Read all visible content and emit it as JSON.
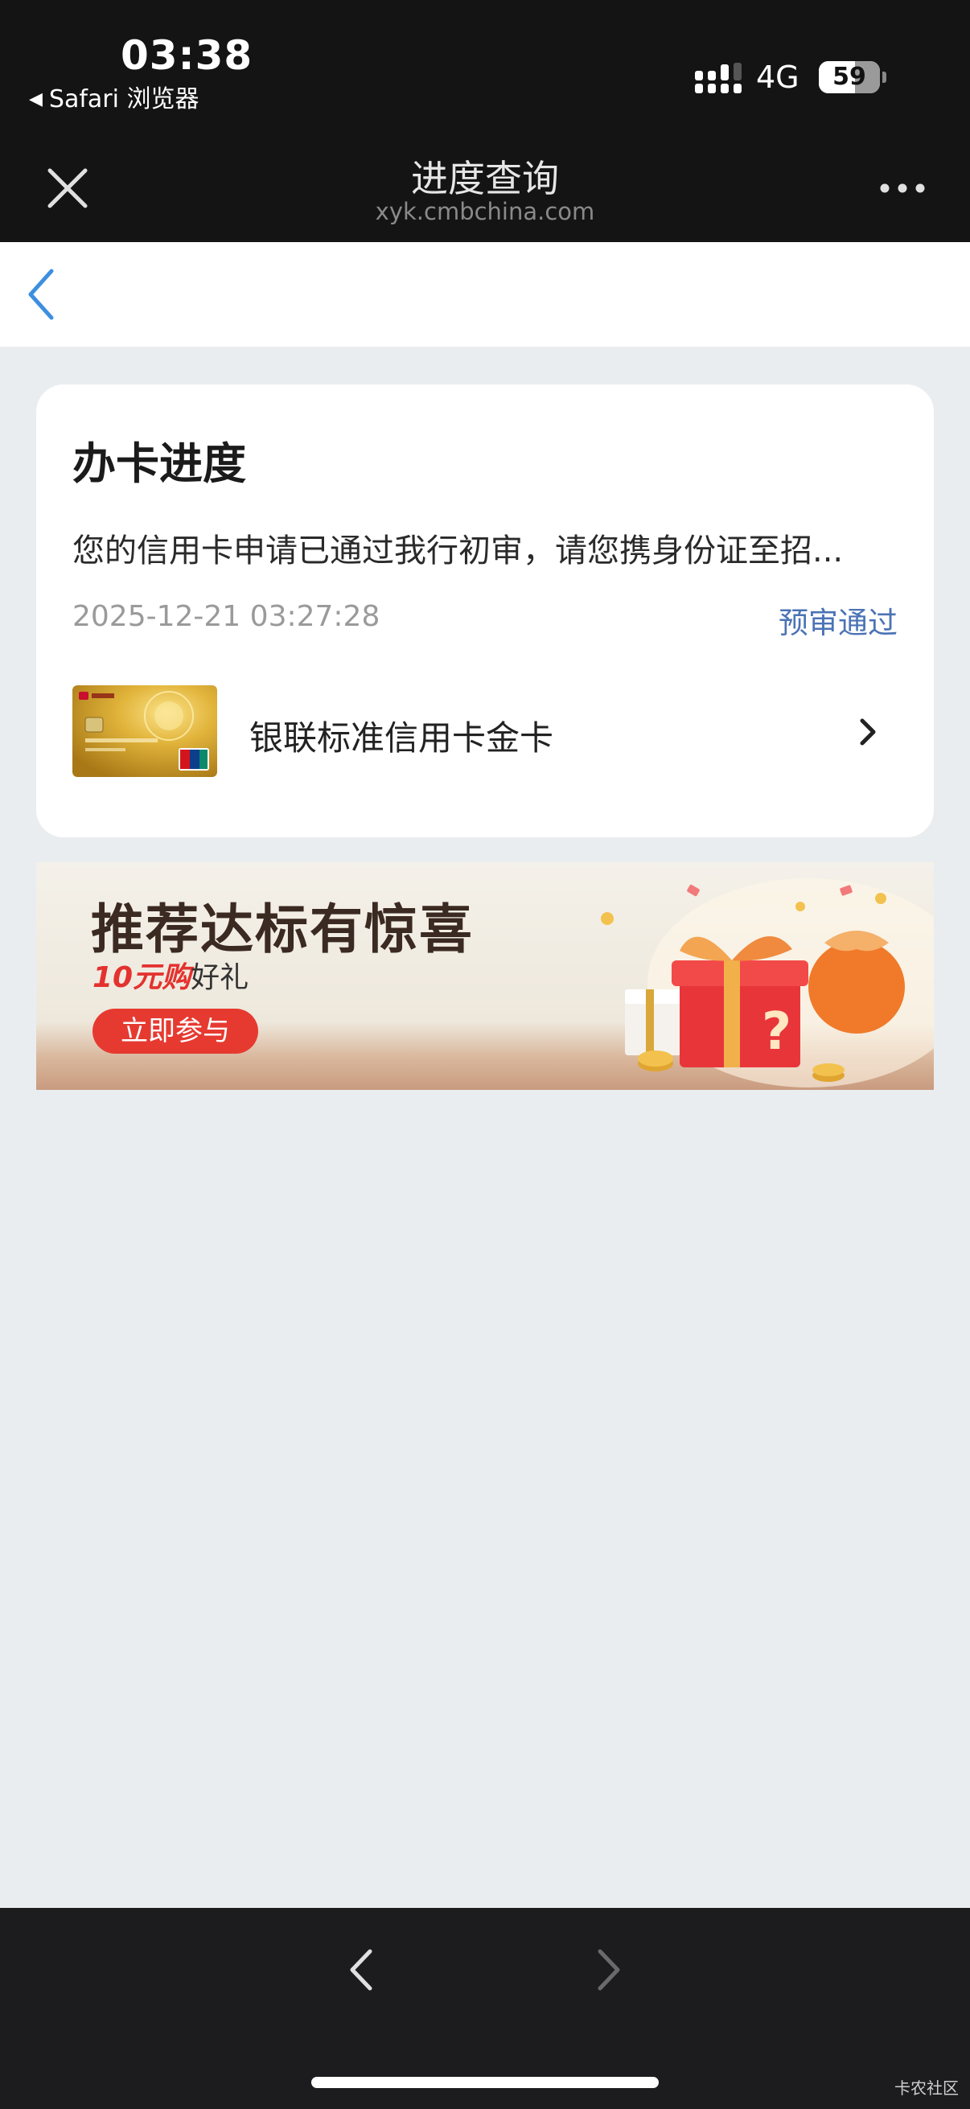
{
  "status_bar": {
    "time": "03:38",
    "back_app": "Safari 浏览器",
    "network": "4G",
    "battery": "59"
  },
  "nav": {
    "title": "进度查询",
    "url": "xyk.cmbchina.com"
  },
  "progress_card": {
    "title": "办卡进度",
    "message": "您的信用卡申请已通过我行初审，请您携身份证至招...",
    "datetime": "2025-12-21 03:27:28",
    "status": "预审通过",
    "card_name": "银联标准信用卡金卡"
  },
  "banner": {
    "title": "推荐达标有惊喜",
    "subtitle_highlight": "10元购",
    "subtitle_rest": "好礼",
    "button": "立即参与"
  },
  "watermark": "卡农社区",
  "colors": {
    "status_accent": "#4b73b5",
    "back_arrow": "#3d8fe0",
    "banner_button": "#e63a30"
  }
}
